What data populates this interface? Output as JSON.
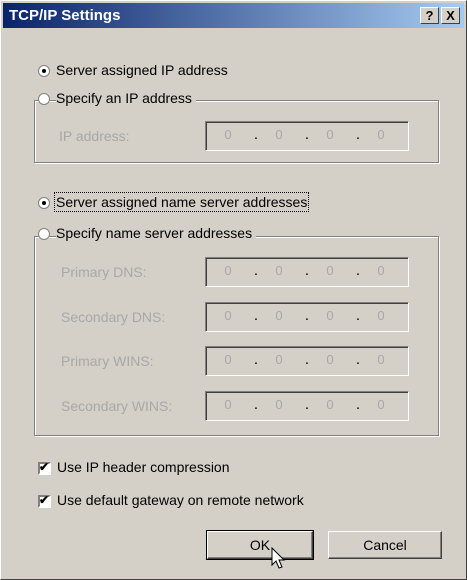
{
  "window": {
    "title": "TCP/IP Settings",
    "help_label": "?",
    "close_label": "X"
  },
  "ip_section": {
    "server_assigned_label": "Server assigned IP address",
    "specify_label": "Specify an IP address",
    "selected": "server_assigned",
    "ip_address_label": "IP address:",
    "ip_address": [
      "0",
      "0",
      "0",
      "0"
    ]
  },
  "dns_section": {
    "server_assigned_label": "Server assigned name server addresses",
    "specify_label": "Specify name server addresses",
    "selected": "server_assigned",
    "fields": [
      {
        "label": "Primary DNS:",
        "octets": [
          "0",
          "0",
          "0",
          "0"
        ]
      },
      {
        "label": "Secondary DNS:",
        "octets": [
          "0",
          "0",
          "0",
          "0"
        ]
      },
      {
        "label": "Primary WINS:",
        "octets": [
          "0",
          "0",
          "0",
          "0"
        ]
      },
      {
        "label": "Secondary WINS:",
        "octets": [
          "0",
          "0",
          "0",
          "0"
        ]
      }
    ]
  },
  "options": {
    "ip_header_compression_label": "Use IP header compression",
    "ip_header_compression_checked": true,
    "default_gateway_label": "Use default gateway on remote network",
    "default_gateway_checked": true
  },
  "buttons": {
    "ok_label": "OK",
    "cancel_label": "Cancel"
  }
}
